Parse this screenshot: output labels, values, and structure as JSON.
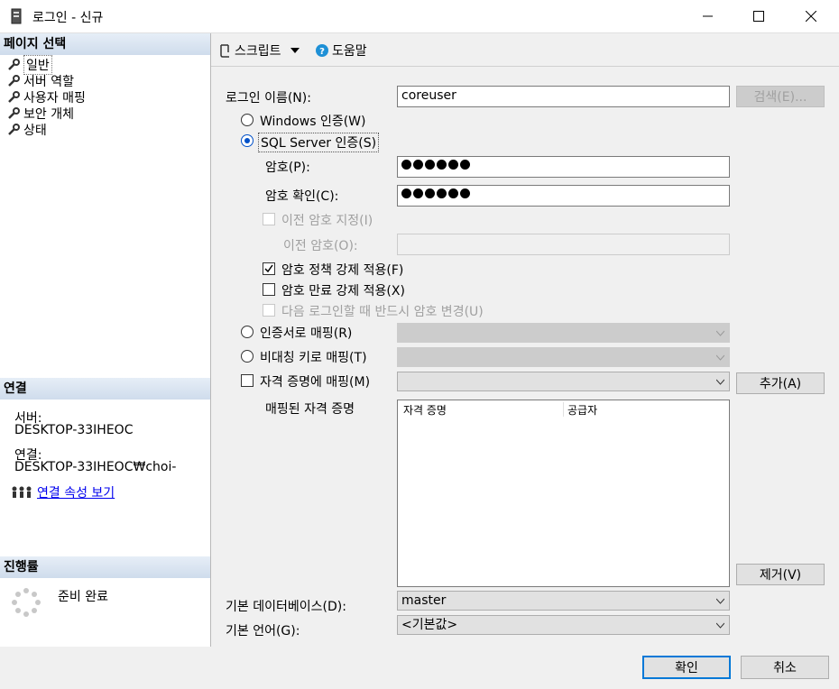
{
  "window": {
    "title": "로그인 - 신규"
  },
  "left": {
    "page_select_header": "페이지 선택",
    "nav": [
      {
        "label": "일반"
      },
      {
        "label": "서버 역할"
      },
      {
        "label": "사용자 매핑"
      },
      {
        "label": "보안 개체"
      },
      {
        "label": "상태"
      }
    ],
    "connection_header": "연결",
    "server_label": "서버:",
    "server_value": "DESKTOP-33IHEOC",
    "connection_label": "연결:",
    "connection_value": "DESKTOP-33IHEOC₩choi-",
    "view_props_link": "연결 속성 보기",
    "progress_header": "진행률",
    "progress_status": "준비 완료"
  },
  "toolbar": {
    "script_label": "스크립트",
    "help_label": "도움말"
  },
  "form": {
    "login_name_label": "로그인 이름(N):",
    "login_name_value": "coreuser",
    "search_button": "검색(E)...",
    "windows_auth": "Windows 인증(W)",
    "sql_auth": "SQL Server 인증(S)",
    "password_label": "암호(P):",
    "confirm_label": "암호 확인(C):",
    "specify_old": "이전 암호 지정(I)",
    "old_password_label": "이전 암호(O):",
    "enforce_policy": "암호 정책 강제 적용(F)",
    "enforce_expiration": "암호 만료 강제 적용(X)",
    "must_change": "다음 로그인할 때 반드시 암호 변경(U)",
    "cert_mapping": "인증서로 매핑(R)",
    "asym_key_mapping": "비대칭 키로 매핑(T)",
    "credential_mapping": "자격 증명에 매핑(M)",
    "add_button": "추가(A)",
    "mapped_credentials_label": "매핑된 자격 증명",
    "col_credential": "자격 증명",
    "col_provider": "공급자",
    "remove_button": "제거(V)",
    "default_db_label": "기본 데이터베이스(D):",
    "default_db_value": "master",
    "default_lang_label": "기본 언어(G):",
    "default_lang_value": "<기본값>"
  },
  "footer": {
    "ok_button": "확인",
    "cancel_button": "취소"
  }
}
